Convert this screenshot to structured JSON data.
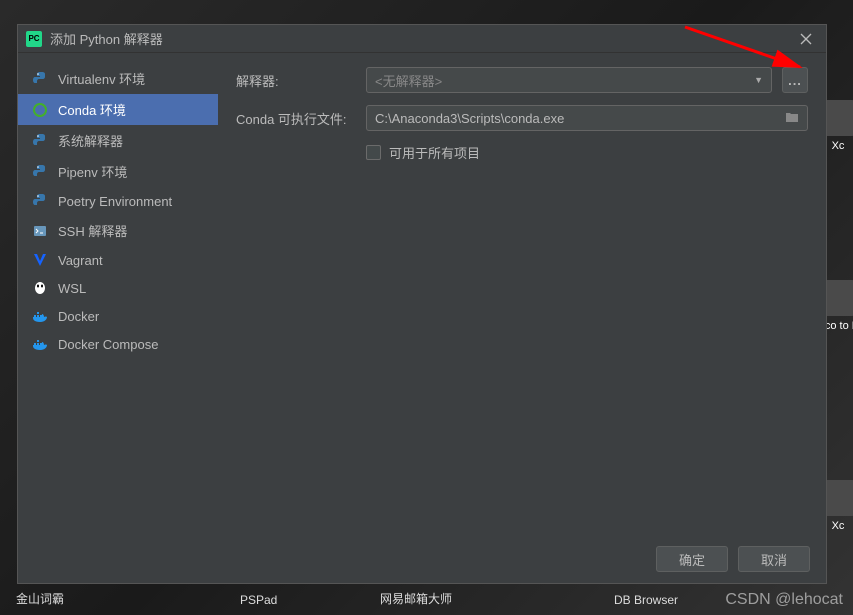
{
  "dialog": {
    "title": "添加 Python 解释器"
  },
  "sidebar": {
    "items": [
      {
        "label": "Virtualenv 环境",
        "icon": "python-icon",
        "color": "#3776ab"
      },
      {
        "label": "Conda 环境",
        "icon": "conda-icon",
        "color": "#43b02a",
        "selected": true
      },
      {
        "label": "系统解释器",
        "icon": "python-icon",
        "color": "#3776ab"
      },
      {
        "label": "Pipenv 环境",
        "icon": "python-icon",
        "color": "#3776ab"
      },
      {
        "label": "Poetry Environment",
        "icon": "python-icon",
        "color": "#3776ab"
      },
      {
        "label": "SSH 解释器",
        "icon": "ssh-icon",
        "color": "#6897bb"
      },
      {
        "label": "Vagrant",
        "icon": "vagrant-icon",
        "color": "#1563ff"
      },
      {
        "label": "WSL",
        "icon": "wsl-icon",
        "color": "#fff"
      },
      {
        "label": "Docker",
        "icon": "docker-icon",
        "color": "#2496ed"
      },
      {
        "label": "Docker Compose",
        "icon": "docker-icon",
        "color": "#2496ed"
      }
    ]
  },
  "form": {
    "interpreter_label": "解释器:",
    "interpreter_value": "<无解释器>",
    "conda_exe_label": "Conda 可执行文件:",
    "conda_exe_value": "C:\\Anaconda3\\Scripts\\conda.exe",
    "available_all_label": "可用于所有项目",
    "browse_label": "..."
  },
  "footer": {
    "ok_label": "确定",
    "cancel_label": "取消"
  },
  "taskbar": {
    "items": [
      "金山词霸",
      "PSPad",
      "网易邮箱大师",
      "DB Browser"
    ]
  },
  "desktop": {
    "icon1": "Xc",
    "icon2": "Xco to F",
    "icon3": "Xc"
  },
  "watermark": "CSDN @lehocat"
}
